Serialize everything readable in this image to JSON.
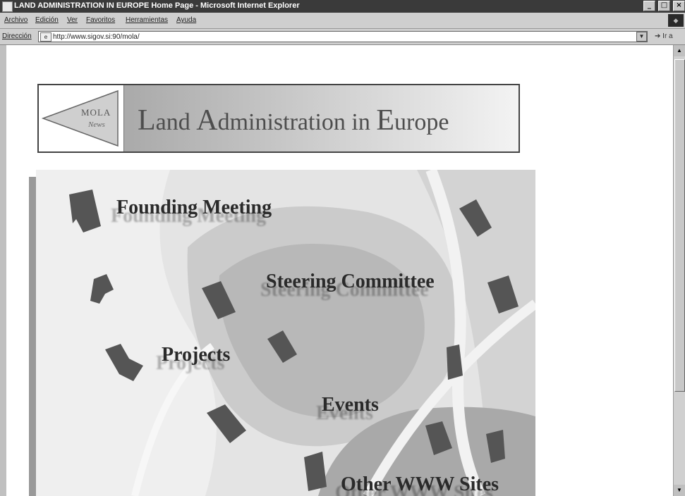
{
  "window": {
    "title": "LAND ADMINISTRATION IN EUROPE Home Page - Microsoft Internet Explorer",
    "buttons": {
      "minimize": "_",
      "maximize": "□",
      "close": "×"
    }
  },
  "menu": [
    "Archivo",
    "Edición",
    "Ver",
    "Favoritos",
    "Herramientas",
    "Ayuda"
  ],
  "address": {
    "label": "Dirección",
    "url": "http://www.sigov.si:90/mola/",
    "go": "Ir a"
  },
  "banner": {
    "logo_line1": "MOLA",
    "logo_line2": "News",
    "title_parts": [
      "L",
      "and ",
      "A",
      "dministration in ",
      "E",
      "urope"
    ]
  },
  "map": {
    "links": [
      "Founding Meeting",
      "Steering Committee",
      "Projects",
      "Events",
      "Other WWW Sites"
    ]
  },
  "colors": {
    "titlebar": "#3a3a3a",
    "page_bg": "#ffffff",
    "house": "#555555"
  },
  "icons": [
    "ie-app-icon",
    "page-icon",
    "dropdown-icon",
    "go-arrow-icon",
    "scroll-up-icon",
    "scroll-down-icon"
  ]
}
